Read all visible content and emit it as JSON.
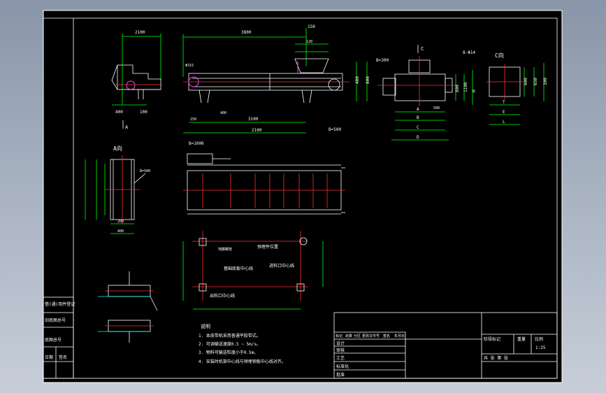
{
  "colors": {
    "sheet": "#000000",
    "frame": "#ffffff",
    "dim": "#00ff00",
    "center": "#ff3030",
    "part": "#ffffff",
    "accent": "#ff40ff",
    "hatch": "#00ffff"
  },
  "views": {
    "a_view_label": "A",
    "a_view_title": "A向",
    "c_view_label": "C",
    "c_view_title": "C向",
    "holes_label": "8-Φ14"
  },
  "dimensions": {
    "top_left": "2100",
    "top_main": "3800",
    "main_total": "3100",
    "main_lower": "2100",
    "left_lower": "400",
    "left_small": "100",
    "main_right_h": "480",
    "main_height": "800",
    "c_width": "800",
    "c_height": "1100",
    "c_aux": "600",
    "c_side": "650",
    "bw_left": "B=500",
    "bw_c": "B=300",
    "bw_mid": "B=500",
    "bw_lower": "B=1000",
    "dim_a": "A",
    "dim_b": "B",
    "dim_c": "C",
    "dim_d": "D",
    "dim_l": "L",
    "dim_h": "H",
    "dim_e": "E",
    "dim_t": "T",
    "dim_n1": "400",
    "dim_n2": "250",
    "dim_n3": "200",
    "dim_n4": "300",
    "dim_n5": "500",
    "dim_n6": "150",
    "dim_n7": "120",
    "dim_n8": "Φ315"
  },
  "layout_labels": {
    "lbl1": "预埋件位置",
    "lbl2": "基础底板中心线",
    "lbl3": "进料口中心线",
    "lbl4": "出料口中心线",
    "lbl5": "地脚螺栓"
  },
  "notes": {
    "heading": "说明",
    "items": [
      "1. 本皮带机采用普通平胶带式。",
      "2. 可调输送速度0.5 ~ 5m/s。",
      "3. 物料可输送粒度小于0.5m。",
      "4. 安装时机架中心线与预埋钢板中心线对齐。"
    ]
  },
  "side_stamps": [
    "借(通)用件登记",
    "旧底图总号",
    "底图总号",
    "日期",
    "签名"
  ],
  "title_block": {
    "row1": [
      "标记",
      "处数",
      "分区",
      "更改文件号",
      "签名",
      "年月日"
    ],
    "design": "设计",
    "check": "审核",
    "process": "工艺",
    "standard": "标准化",
    "approve": "批准",
    "stage_mark": "阶段标记",
    "weight": "重量",
    "scale_label": "比例",
    "scale_value": "1:25",
    "sheets": "共  张   第  张"
  }
}
